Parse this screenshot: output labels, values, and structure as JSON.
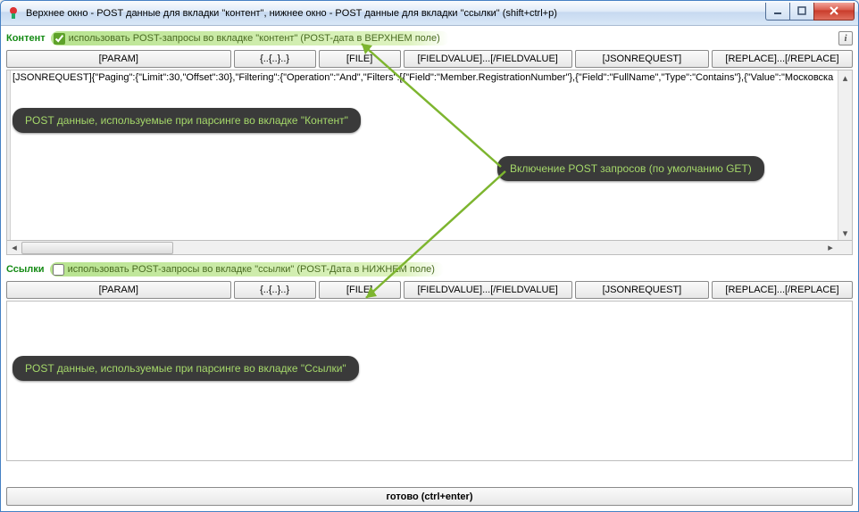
{
  "window": {
    "title": "Верхнее окно - POST данные для вкладки \"контент\", нижнее окно - POST данные для вкладки \"ссылки\" (shift+ctrl+p)"
  },
  "top": {
    "label": "Контент",
    "check_label": "использовать POST-запросы во вкладке \"контент\" (POST-дата в ВЕРХНЕМ поле)",
    "info_label": "i",
    "editor_text": "[JSONREQUEST]{\"Paging\":{\"Limit\":30,\"Offset\":30},\"Filtering\":{\"Operation\":\"And\",\"Filters\":[{\"Field\":\"Member.RegistrationNumber\"},{\"Field\":\"FullName\",\"Type\":\"Contains\"},{\"Value\":\"Московска"
  },
  "bottom": {
    "label": "Ссылки",
    "check_label": "использовать POST-запросы во вкладке \"ссылки\" (POST-Дата в НИЖНЕМ поле)"
  },
  "toolbar": {
    "param": "[PARAM]",
    "brace": "{..{..}..}",
    "file": "[FILE]",
    "fieldvalue": "[FIELDVALUE]...[/FIELDVALUE]",
    "json": "[JSONREQUEST]",
    "replace": "[REPLACE]...[/REPLACE]"
  },
  "callouts": {
    "c_top": "POST данные, используемые при парсинге во вкладке \"Контент\"",
    "c_mid": "Включение POST запросов (по умолчанию GET)",
    "c_bot": "POST данные, используемые при парсинге во вкладке \"Ссылки\""
  },
  "footer": {
    "label": "готово (ctrl+enter)"
  }
}
